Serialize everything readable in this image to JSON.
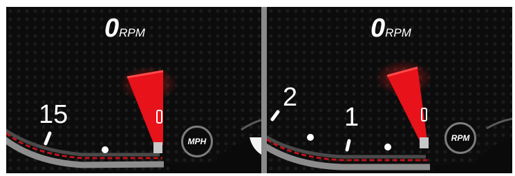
{
  "left_gauge": {
    "rpm_value": "0",
    "rpm_unit": "RPM",
    "tick_label": "15",
    "mode_button_label": "MPH"
  },
  "right_gauge": {
    "rpm_value": "0",
    "rpm_unit": "RPM",
    "tick_labels": [
      "2",
      "1"
    ],
    "mode_button_label": "RPM"
  },
  "colors": {
    "needle": "#e8121a",
    "redline": "#c0121a",
    "background": "#0c0c0c",
    "text": "#ffffff"
  }
}
